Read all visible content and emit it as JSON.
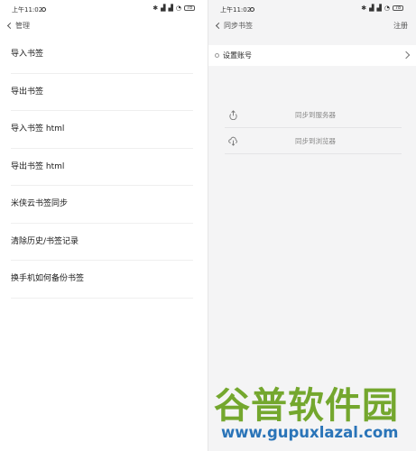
{
  "status_bar": {
    "time": "上午11:02",
    "battery": "78"
  },
  "left_screen": {
    "nav": {
      "back_label": "管理"
    },
    "menu_items": [
      {
        "label": "导入书签"
      },
      {
        "label": "导出书签"
      },
      {
        "label": "导入书签 html"
      },
      {
        "label": "导出书签 html"
      },
      {
        "label": "米侠云书签同步"
      },
      {
        "label": "清除历史/书签记录"
      },
      {
        "label": "换手机如何备份书签"
      }
    ]
  },
  "right_screen": {
    "nav": {
      "back_label": "同步书签",
      "action_label": "注册"
    },
    "account_row": {
      "label": "设置账号"
    },
    "sync_options": [
      {
        "label": "同步到服务器",
        "icon": "upload-icon"
      },
      {
        "label": "同步到浏览器",
        "icon": "cloud-download-icon"
      }
    ]
  },
  "watermark": {
    "logo_text": "谷普软件园",
    "url": "www.gupuxlazal.com",
    "logo_color": "#74a72e",
    "url_color": "#2a74b8"
  }
}
